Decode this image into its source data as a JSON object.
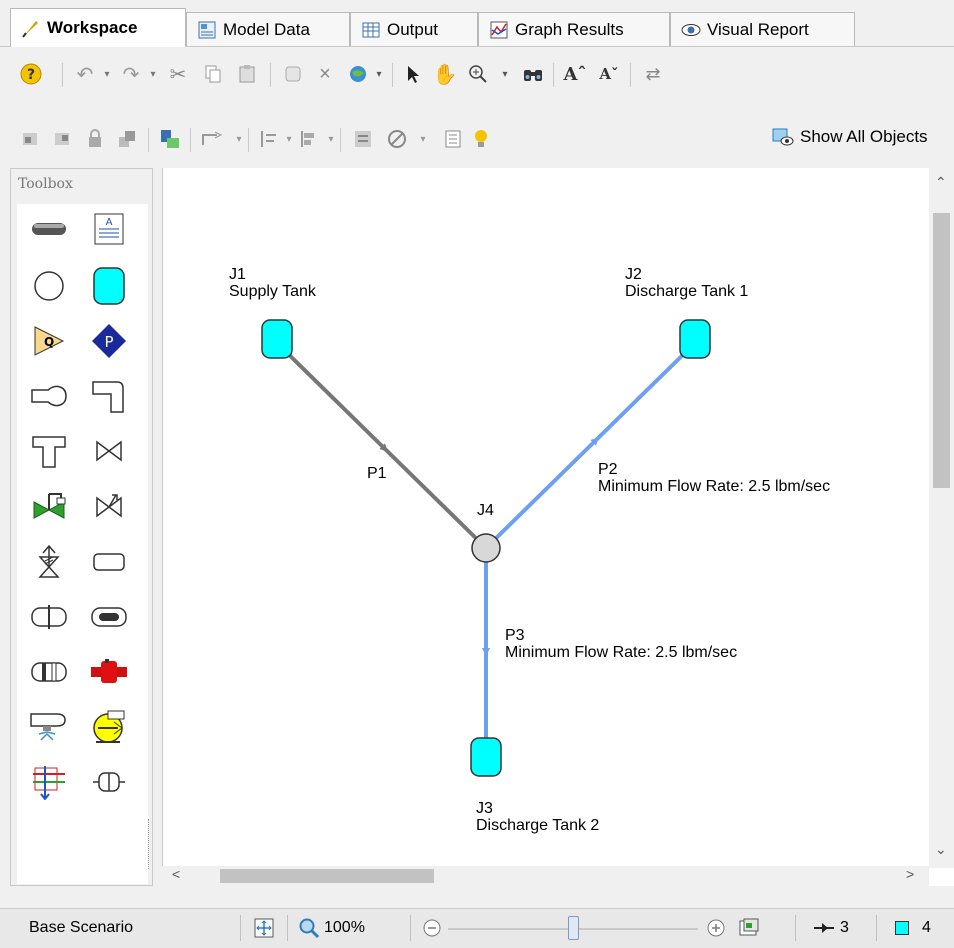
{
  "tabs": [
    {
      "label": "Workspace",
      "icon": "workspace-icon"
    },
    {
      "label": "Model Data",
      "icon": "model-data-icon"
    },
    {
      "label": "Output",
      "icon": "output-icon"
    },
    {
      "label": "Graph Results",
      "icon": "graph-results-icon"
    },
    {
      "label": "Visual Report",
      "icon": "visual-report-icon"
    }
  ],
  "toolbar2": {
    "show_all_objects": "Show All Objects"
  },
  "toolbox": {
    "title": "Toolbox"
  },
  "network": {
    "junctions": [
      {
        "id": "J1",
        "name": "Supply Tank",
        "type": "tank"
      },
      {
        "id": "J2",
        "name": "Discharge Tank 1",
        "type": "tank"
      },
      {
        "id": "J3",
        "name": "Discharge Tank 2",
        "type": "tank"
      },
      {
        "id": "J4",
        "name": "",
        "type": "branch"
      }
    ],
    "pipes": [
      {
        "id": "P1",
        "note": ""
      },
      {
        "id": "P2",
        "note": "Minimum Flow Rate: 2.5 lbm/sec"
      },
      {
        "id": "P3",
        "note": "Minimum Flow Rate: 2.5 lbm/sec"
      }
    ],
    "colors": {
      "default_pipe": "#767676",
      "highlight_pipe": "#6e9ff0",
      "tank_fill": "#00ffff",
      "branch_fill": "#d8d8d8"
    }
  },
  "status": {
    "scenario": "Base Scenario",
    "zoom": "100%",
    "zoom_slider": 0.5,
    "pipe_count": "3",
    "junction_count": "4"
  }
}
